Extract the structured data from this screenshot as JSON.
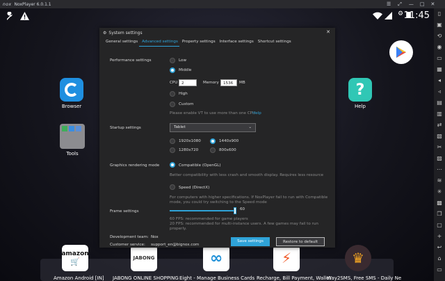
{
  "window": {
    "logo": "nox",
    "title": "NoxPlayer 6.0.1.1",
    "controls": [
      "minimize-icon",
      "maximize-icon",
      "close-icon"
    ]
  },
  "status": {
    "time": "11:45"
  },
  "desktop": {
    "icons": [
      {
        "label": "Browser"
      },
      {
        "label": "Tools"
      },
      {
        "label": "Help"
      }
    ]
  },
  "dock": {
    "apps": [
      {
        "label": "Amazon Android [IN]",
        "icon_text": "amazon"
      },
      {
        "label": "JABONG ONLINE SHOPPING",
        "icon_text": "JABONG"
      },
      {
        "label": "Eight - Manage Business Cards",
        "icon_text": "∞"
      },
      {
        "label": "Recharge, Bill Payment, Wallet",
        "icon_text": "⚡"
      },
      {
        "label": "Way2SMS, Free SMS - Daily Ne",
        "icon_text": "♛"
      }
    ]
  },
  "dialog": {
    "title": "System settings",
    "tabs": [
      "General settings",
      "Advanced settings",
      "Property settings",
      "Interface settings",
      "Shortcut settings"
    ],
    "active_tab": "Advanced settings",
    "performance": {
      "label": "Performance settings",
      "options": [
        "Low",
        "Middle",
        "High",
        "Custom"
      ],
      "selected": "Middle",
      "cpu_label": "CPU",
      "cpu_value": "2",
      "memory_label": "Memory",
      "memory_value": "1536",
      "memory_unit": "MB",
      "vt_note": "Please enable VT to use more than one CPU",
      "vt_link": "Help"
    },
    "startup": {
      "label": "Startup settings",
      "device": "Tablet",
      "resolutions": [
        "1920x1080",
        "1440x900",
        "1280x720",
        "800x600"
      ],
      "selected": "1440x900"
    },
    "graphics": {
      "label": "Graphics rendering mode",
      "opengl_label": "Compatible (OpenGL)",
      "opengl_desc": "Better compatibility with less crash and smooth display. Requires less resource",
      "directx_label": "Speed (DirectX)",
      "directx_desc_1": "For computers with higher specifications. If NoxPlayer fail to run with Compatible",
      "directx_desc_2": "mode, you could try switching to the Speed mode",
      "selected": "Compatible (OpenGL)"
    },
    "frames": {
      "label": "Frame settings",
      "value": "60",
      "value_fraction": 1.0,
      "note_1": "60 FPS: recommended for game players",
      "note_2": "20 FPS: recommended for multi-instance users. A few games may fail to run",
      "note_3": "properly."
    },
    "footer": {
      "dev_label": "Development team:",
      "dev_value": "Nox",
      "support_label": "Customer service:",
      "support_value": "support_en@bignox.com",
      "save": "Save settings",
      "restore": "Restore to default"
    }
  },
  "colors": {
    "accent": "#2fa3d8",
    "dialog_bg": "#252526",
    "titlebar_bg": "#2a2a2e"
  }
}
